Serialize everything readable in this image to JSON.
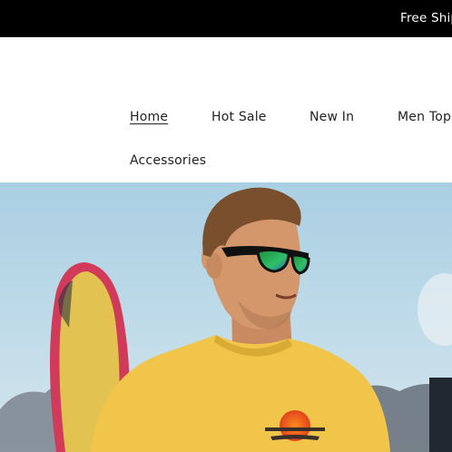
{
  "announcement": {
    "text": "Free Shipping"
  },
  "nav": {
    "items": [
      {
        "label": "Home",
        "active": true
      },
      {
        "label": "Hot Sale",
        "active": false
      },
      {
        "label": "New In",
        "active": false
      },
      {
        "label": "Men Tops",
        "active": false
      },
      {
        "label": "Accessories",
        "active": false
      }
    ]
  },
  "hero": {
    "subject": "man-with-sunglasses-and-surfboard",
    "colors": {
      "sky": "#b9d7e6",
      "shirt": "#f0c54a",
      "board": "#e2c251",
      "board_rim": "#d23a59"
    }
  }
}
